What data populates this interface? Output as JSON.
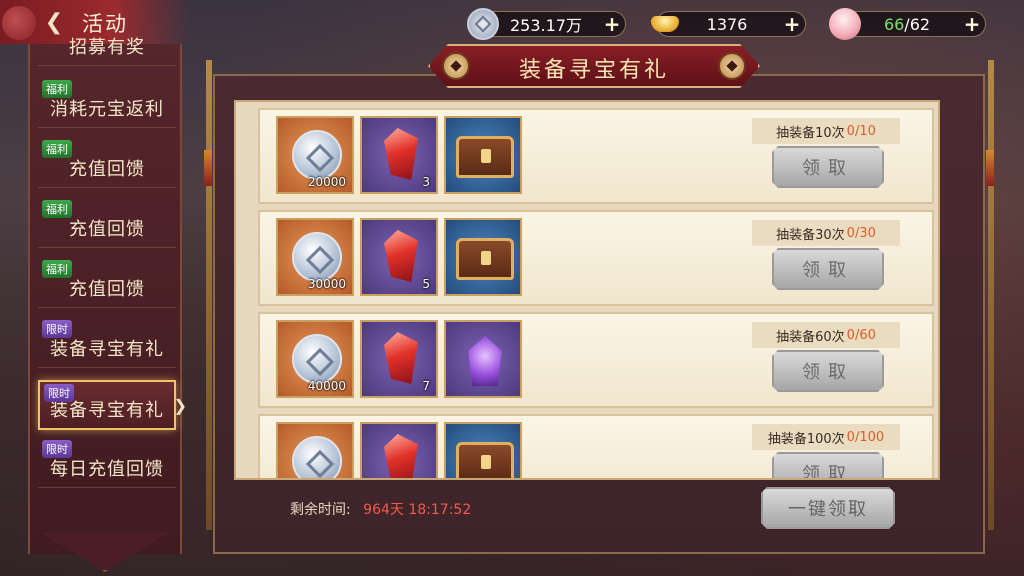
{
  "header": {
    "title": "活动",
    "silver": "253.17万",
    "ingot": "1376",
    "stamina_current": "66",
    "stamina_sep": "/",
    "stamina_max": "62"
  },
  "sidebar": {
    "items": [
      {
        "label": "招募有奖",
        "tag": ""
      },
      {
        "label": "消耗元宝返利",
        "tag": "福利"
      },
      {
        "label": "充值回馈",
        "tag": "福利"
      },
      {
        "label": "充值回馈",
        "tag": "福利"
      },
      {
        "label": "充值回馈",
        "tag": "福利"
      },
      {
        "label": "装备寻宝有礼",
        "tag": "限时"
      },
      {
        "label": "装备寻宝有礼",
        "tag": "限时",
        "active": true
      },
      {
        "label": "每日充值回馈",
        "tag": "限时"
      }
    ]
  },
  "panel": {
    "title": "装备寻宝有礼",
    "rows": [
      {
        "coin": "20000",
        "gem": "3",
        "third": "chest",
        "task": "抽装备10次",
        "progress": "0/10",
        "button": "领取"
      },
      {
        "coin": "30000",
        "gem": "5",
        "third": "chest",
        "task": "抽装备30次",
        "progress": "0/30",
        "button": "领取"
      },
      {
        "coin": "40000",
        "gem": "7",
        "third": "crystal",
        "task": "抽装备60次",
        "progress": "0/60",
        "button": "领取"
      },
      {
        "coin": "",
        "gem": "",
        "third": "chest",
        "task": "抽装备100次",
        "progress": "0/100",
        "button": "领取"
      }
    ],
    "remaining_label": "剩余时间:",
    "remaining_time": "964天 18:17:52",
    "claim_all": "一键领取"
  },
  "colors": {
    "accent": "#f0c664",
    "progress": "#e05a2a",
    "timer": "#f05b4a",
    "stamina": "#7ce26a"
  }
}
